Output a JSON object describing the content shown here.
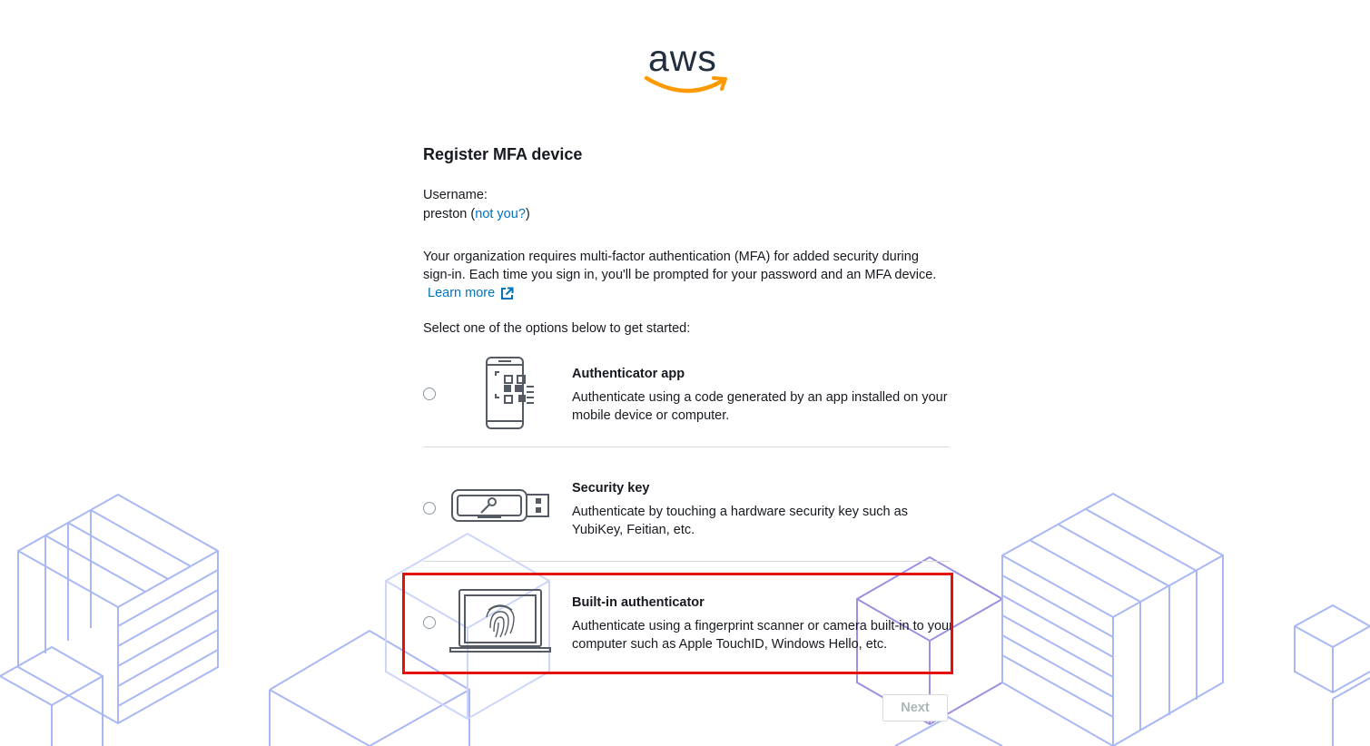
{
  "brand": {
    "logo_text": "aws",
    "smile_color": "#ff9900",
    "text_color": "#232f3e"
  },
  "page": {
    "title": "Register MFA device",
    "username_label": "Username:",
    "username": "preston",
    "paren_open": "(",
    "not_you": "not you?",
    "paren_close": ")",
    "description": "Your organization requires multi-factor authentication (MFA) for added security during sign-in. Each time you sign in, you'll be prompted for your password and an MFA device.",
    "learn_more": "Learn more",
    "select_prompt": "Select one of the options below to get started:"
  },
  "options": [
    {
      "title": "Authenticator app",
      "text": "Authenticate using a code generated by an app installed on your mobile device or computer.",
      "icon": "phone-qr-icon",
      "selected": false
    },
    {
      "title": "Security key",
      "text": "Authenticate by touching a hardware security key such as YubiKey, Feitian, etc.",
      "icon": "usb-key-icon",
      "selected": false
    },
    {
      "title": "Built-in authenticator",
      "text": "Authenticate using a fingerprint scanner or camera built-in to your computer such as Apple TouchID, Windows Hello, etc.",
      "icon": "laptop-fingerprint-icon",
      "selected": false,
      "highlighted": true
    }
  ],
  "actions": {
    "next_label": "Next",
    "next_enabled": false
  },
  "colors": {
    "link": "#0073bb",
    "highlight": "#e3120b",
    "background_art": "#a9b8f5"
  }
}
